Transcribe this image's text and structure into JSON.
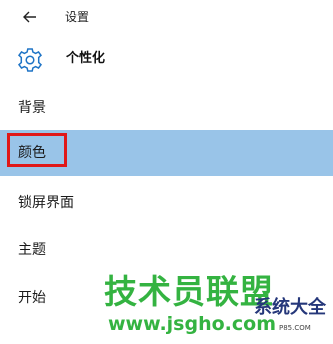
{
  "topbar": {
    "back_icon": "arrow-left-icon",
    "title": "设置"
  },
  "header": {
    "icon": "gear-icon",
    "title": "个性化"
  },
  "nav": {
    "items": [
      {
        "label": "背景",
        "selected": false
      },
      {
        "label": "颜色",
        "selected": true
      },
      {
        "label": "锁屏界面",
        "selected": false
      },
      {
        "label": "主题",
        "selected": false
      },
      {
        "label": "开始",
        "selected": false
      }
    ]
  },
  "watermark": {
    "main": "技术员联盟",
    "url": "www.jsgho.com",
    "side": "系统大全",
    "small": "P85.COM"
  },
  "colors": {
    "accent": "#0078d7",
    "selected_bg": "#99c4e8",
    "highlight_border": "#e01818",
    "watermark_green": "#34b341"
  }
}
